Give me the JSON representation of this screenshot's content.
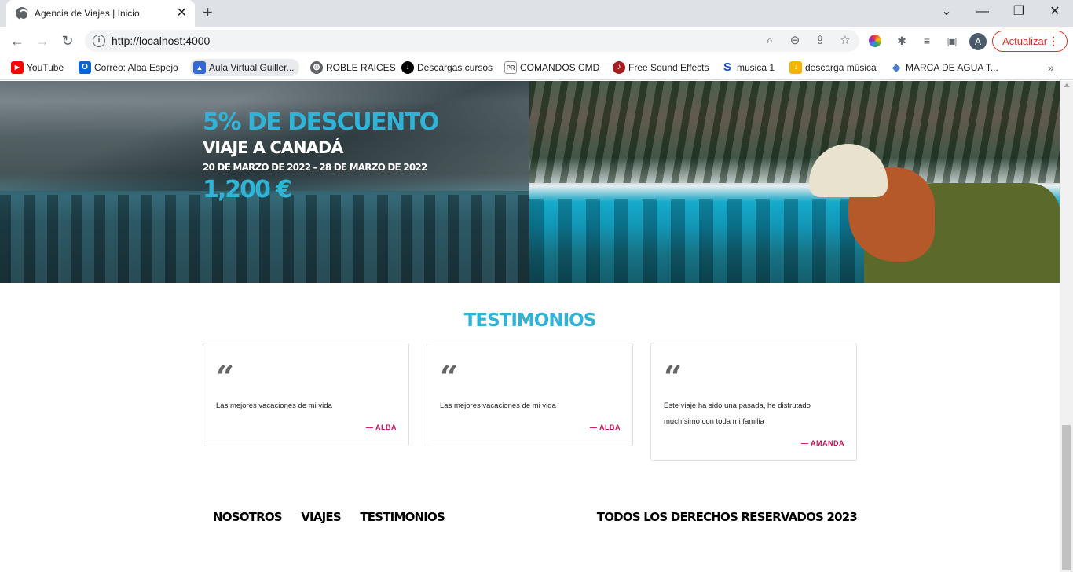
{
  "browser": {
    "tab_title": "Agencia de Viajes | Inicio",
    "url": "http://localhost:4000",
    "update_label": "Actualizar",
    "avatar_letter": "A",
    "bookmarks": [
      {
        "label": "YouTube",
        "icon": "youtube-icon",
        "color": "#ff0000"
      },
      {
        "label": "Correo: Alba Espejo",
        "icon": "outlook-icon",
        "color": "#0a64d6"
      },
      {
        "label": "Aula Virtual Guiller...",
        "icon": "graduation-cap-icon",
        "color": "#3367d6"
      },
      {
        "label": "ROBLE RAICES",
        "icon": "globe-icon",
        "color": "#5f6368"
      },
      {
        "label": "Descargas cursos",
        "icon": "download-badge-icon",
        "color": "#000000"
      },
      {
        "label": "COMANDOS CMD",
        "icon": "pr-icon",
        "color": "#555555"
      },
      {
        "label": "Free Sound Effects",
        "icon": "sound-icon",
        "color": "#a32020"
      },
      {
        "label": "musica 1",
        "icon": "s-icon",
        "color": "#1a4fbf"
      },
      {
        "label": "descarga música",
        "icon": "folder-download-icon",
        "color": "#f4b400"
      },
      {
        "label": "MARCA DE AGUA T...",
        "icon": "layers-icon",
        "color": "#4a7fd0"
      }
    ]
  },
  "hero": {
    "discount": "5% DE DESCUENTO",
    "trip": "VIAJE A CANADÁ",
    "dates": "20 DE MARZO DE 2022 - 28 DE MARZO DE 2022",
    "price": "1,200 €"
  },
  "testimonials": {
    "title": "TESTIMONIOS",
    "items": [
      {
        "quote": "Las mejores vacaciones de mi vida",
        "author": "— ALBA"
      },
      {
        "quote": "Las mejores vacaciones de mi vida",
        "author": "— ALBA"
      },
      {
        "quote": "Este viaje ha sido una pasada, he disfrutado muchísimo con toda mi familia",
        "author": "— AMANDA"
      }
    ]
  },
  "footer": {
    "nav": [
      "NOSOTROS",
      "VIAJES",
      "TESTIMONIOS"
    ],
    "copyright": "TODOS LOS DERECHOS RESERVADOS 2023"
  },
  "colors": {
    "accent": "#2fb4d7",
    "author": "#c4145b",
    "update": "#d93025"
  }
}
